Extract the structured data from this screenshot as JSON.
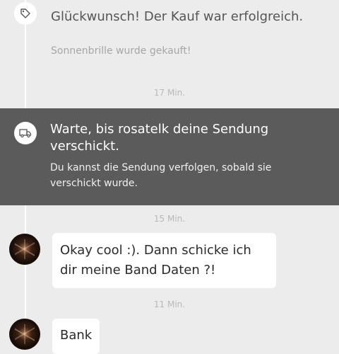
{
  "events": {
    "purchase": {
      "icon": "tag-icon",
      "title": "Glückwunsch! Der Kauf war erfolgreich.",
      "subtitle": "Sonnenbrille wurde gekauft!",
      "time": "17 Min."
    },
    "shipping": {
      "icon": "truck-icon",
      "title": "Warte, bis rosatelk deine Sendung verschickt.",
      "subtitle": "Du kannst die Sendung verfolgen, sobald sie verschickt wurde.",
      "time": "15 Min."
    }
  },
  "messages": [
    {
      "text": "Okay cool :). Dann schicke ich dir meine Band Daten ?!",
      "time": "11 Min."
    },
    {
      "text": "Bank"
    }
  ],
  "colors": {
    "background": "#ececec",
    "shipping_block": "#5b5b5b",
    "bubble": "#ffffff"
  }
}
